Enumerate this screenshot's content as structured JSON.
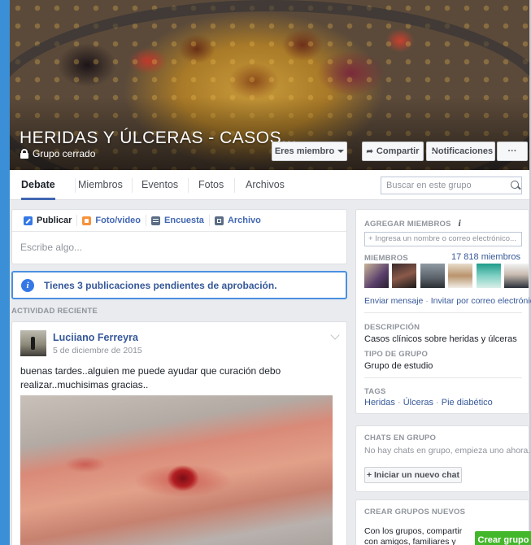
{
  "group": {
    "title": "HERIDAS Y ÚLCERAS - CASOS...",
    "privacy": "Grupo cerrado"
  },
  "cover_buttons": {
    "member": "Eres miembro",
    "share": "Compartir",
    "notifications": "Notificaciones",
    "more": "···"
  },
  "nav": {
    "tabs": [
      {
        "label": "Debate"
      },
      {
        "label": "Miembros"
      },
      {
        "label": "Eventos"
      },
      {
        "label": "Fotos"
      },
      {
        "label": "Archivos"
      }
    ],
    "search_placeholder": "Buscar en este grupo"
  },
  "composer": {
    "tabs": [
      {
        "label": "Publicar"
      },
      {
        "label": "Foto/video"
      },
      {
        "label": "Encuesta"
      },
      {
        "label": "Archivo"
      }
    ],
    "placeholder": "Escribe algo..."
  },
  "pending": {
    "text": "Tienes 3 publicaciones pendientes de aprobación."
  },
  "recent_label": "ACTIVIDAD RECIENTE",
  "post": {
    "author": "Luciiano Ferreyra",
    "date": "5 de diciembre de 2015",
    "text": "buenas tardes..alguien me puede ayudar que curación debo realizar..muchisimas gracias.."
  },
  "sidebar": {
    "add_members_title": "AGREGAR MIEMBROS",
    "add_members_placeholder": "+ Ingresa un nombre o correo electrónico...",
    "members_title": "MIEMBROS",
    "members_count": "17 818 miembros",
    "send_message": "Enviar mensaje",
    "link_separator": " · ",
    "invite_email": "Invitar por correo electrónico",
    "description_title": "DESCRIPCIÓN",
    "description": "Casos clínicos sobre heridas y úlceras",
    "group_type_title": "TIPO DE GRUPO",
    "group_type": "Grupo de estudio",
    "tags_title": "TAGS",
    "tags": [
      "Heridas",
      "Úlceras",
      "Pie diabético"
    ],
    "chats_title": "CHATS EN GRUPO",
    "chats_empty": "No hay chats en grupo, empieza uno ahora.",
    "new_chat": "+ Iniciar un nuevo chat",
    "create_title": "CREAR GRUPOS NUEVOS",
    "create_text_1": "Con los grupos, compartir",
    "create_text_2": "con amigos, familiares y",
    "create_button": "Crear grupo"
  },
  "colors": {
    "accent": "#4267b2",
    "link": "#365899",
    "green": "#42b72a",
    "frame_blue": "#3b8fd6"
  }
}
